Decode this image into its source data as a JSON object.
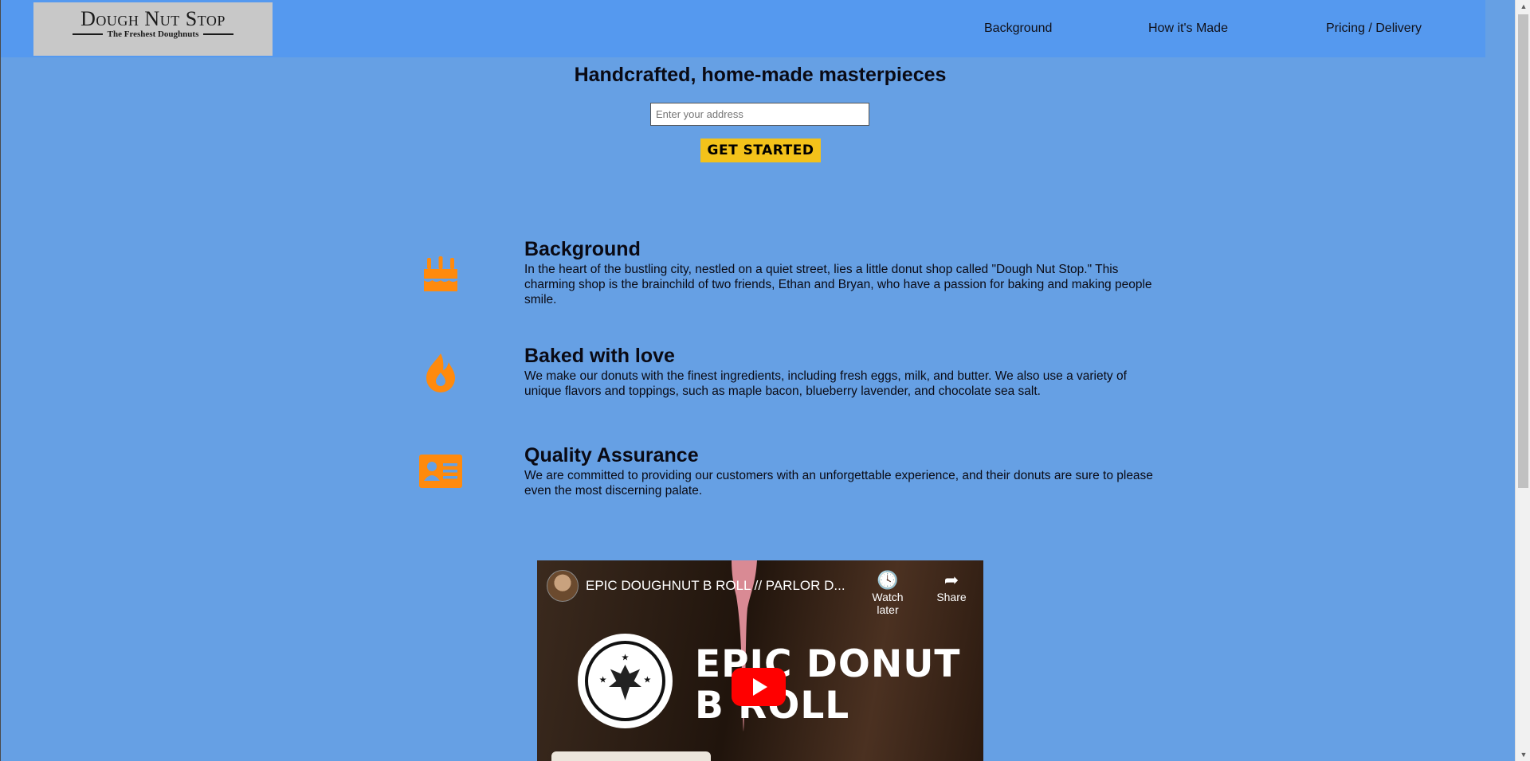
{
  "header": {
    "logo": {
      "brand": "Dough Nut Stop",
      "tagline": "The Freshest Doughnuts"
    },
    "nav": [
      {
        "label": "Background"
      },
      {
        "label": "How it's Made"
      },
      {
        "label": "Pricing / Delivery"
      }
    ]
  },
  "hero": {
    "title": "Handcrafted, home-made masterpieces",
    "address_placeholder": "Enter your address",
    "cta_label": "GET STARTED"
  },
  "features": [
    {
      "icon": "birthday-cake-icon",
      "title": "Background",
      "text": "In the heart of the bustling city, nestled on a quiet street, lies a little donut shop called \"Dough Nut Stop.\" This charming shop is the brainchild of two friends, Ethan and Bryan, who have a passion for baking and making people smile."
    },
    {
      "icon": "fire-icon",
      "title": "Baked with love",
      "text": "We make our donuts with the finest ingredients, including fresh eggs, milk, and butter. We also use a variety of unique flavors and toppings, such as maple bacon, blueberry lavender, and chocolate sea salt."
    },
    {
      "icon": "id-card-icon",
      "title": "Quality Assurance",
      "text": "We are committed to providing our customers with an unforgettable experience, and their donuts are sure to please even the most discerning palate."
    }
  ],
  "video": {
    "title": "EPIC DOUGHNUT B ROLL // PARLOR D...",
    "watch_later": "Watch later",
    "share": "Share",
    "thumbnail_line1": "EPIC DONUT",
    "thumbnail_line2": "B ROLL"
  },
  "colors": {
    "page_bg": "#66a0e4",
    "header_bg": "#5599ef",
    "accent_orange": "#ff8a0d",
    "cta_yellow": "#f3c21a"
  }
}
